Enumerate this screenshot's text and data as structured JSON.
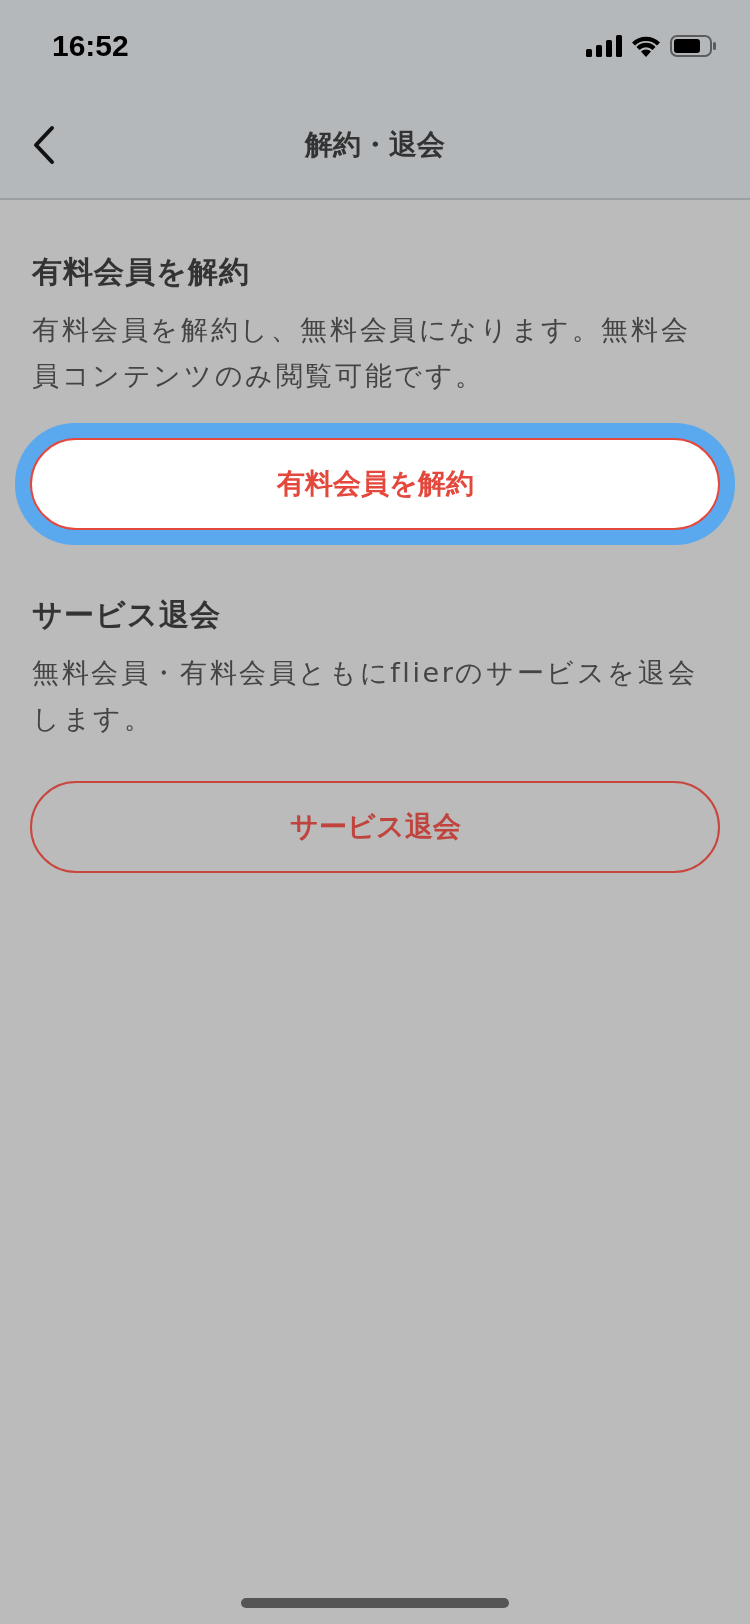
{
  "status_bar": {
    "time": "16:52"
  },
  "nav_bar": {
    "title": "解約・退会"
  },
  "sections": [
    {
      "title": "有料会員を解約",
      "description": "有料会員を解約し、無料会員になります。無料会員コンテンツのみ閲覧可能です。",
      "button": {
        "label": "有料会員を解約",
        "highlighted": true
      }
    },
    {
      "title": "サービス退会",
      "description": "無料会員・有料会員ともにflierのサービスを退会します。",
      "button": {
        "label": "サービス退会",
        "highlighted": false
      }
    }
  ]
}
